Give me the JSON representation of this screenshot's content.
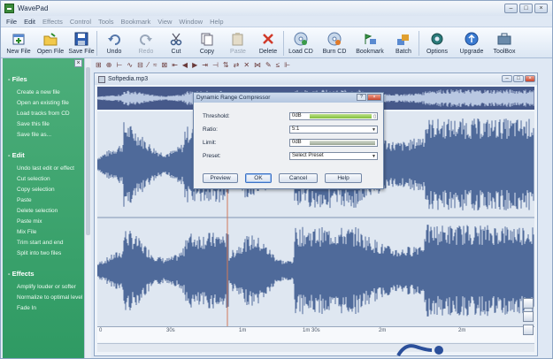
{
  "window": {
    "title": "WavePad"
  },
  "menu": [
    "File",
    "Edit",
    "Effects",
    "Control",
    "Tools",
    "Bookmark",
    "View",
    "Window",
    "Help"
  ],
  "toolbar": [
    {
      "label": "New File",
      "icon": "new-file-icon",
      "disabled": false
    },
    {
      "label": "Open File",
      "icon": "open-folder-icon",
      "disabled": false
    },
    {
      "label": "Save File",
      "icon": "save-icon",
      "disabled": false
    },
    {
      "label": "Undo",
      "icon": "undo-icon",
      "disabled": false
    },
    {
      "label": "Redo",
      "icon": "redo-icon",
      "disabled": true
    },
    {
      "label": "Cut",
      "icon": "scissors-icon",
      "disabled": false
    },
    {
      "label": "Copy",
      "icon": "copy-icon",
      "disabled": false
    },
    {
      "label": "Paste",
      "icon": "paste-icon",
      "disabled": true
    },
    {
      "label": "Delete",
      "icon": "delete-x-icon",
      "disabled": false
    },
    {
      "label": "Load CD",
      "icon": "load-cd-icon",
      "disabled": false
    },
    {
      "label": "Burn CD",
      "icon": "burn-cd-icon",
      "disabled": false
    },
    {
      "label": "Bookmark",
      "icon": "bookmark-icon",
      "disabled": false
    },
    {
      "label": "Batch",
      "icon": "batch-icon",
      "disabled": false
    },
    {
      "label": "Options",
      "icon": "options-gear-icon",
      "disabled": false
    },
    {
      "label": "Upgrade",
      "icon": "upgrade-icon",
      "disabled": false
    },
    {
      "label": "ToolBox",
      "icon": "toolbox-icon",
      "disabled": false
    }
  ],
  "sidebar": {
    "files": {
      "header": "Files",
      "items": [
        "Create a new file",
        "Open an existing file",
        "Load tracks from CD",
        "Save this file",
        "Save file as..."
      ]
    },
    "edit": {
      "header": "Edit",
      "items": [
        "Undo last edit or effect",
        "Cut selection",
        "Copy selection",
        "Paste",
        "Delete selection",
        "Paste mix",
        "Mix File",
        "Trim start and end",
        "Split into two files"
      ]
    },
    "effects": {
      "header": "Effects",
      "items": [
        "Amplify louder or softer",
        "Normalize to optimal level",
        "Fade In"
      ]
    }
  },
  "document": {
    "title": "Softpedia.mp3"
  },
  "ruler": [
    "0",
    "30s",
    "1m",
    "1m 30s",
    "2m",
    "2m"
  ],
  "dialog": {
    "title": "Dynamic Range Compressor",
    "threshold": {
      "label": "Threshold:",
      "value": "0dB"
    },
    "ratio": {
      "label": "Ratio:",
      "value": "5:1"
    },
    "limit": {
      "label": "Limit:",
      "value": "0dB"
    },
    "preset": {
      "label": "Preset:",
      "value": "Select Preset"
    },
    "buttons": {
      "preview": "Preview",
      "ok": "OK",
      "cancel": "Cancel",
      "help": "Help"
    }
  },
  "colors": {
    "sidebar": "#3aa26c",
    "wave": "#4f6a9a",
    "slider_green": "#8cc548"
  }
}
